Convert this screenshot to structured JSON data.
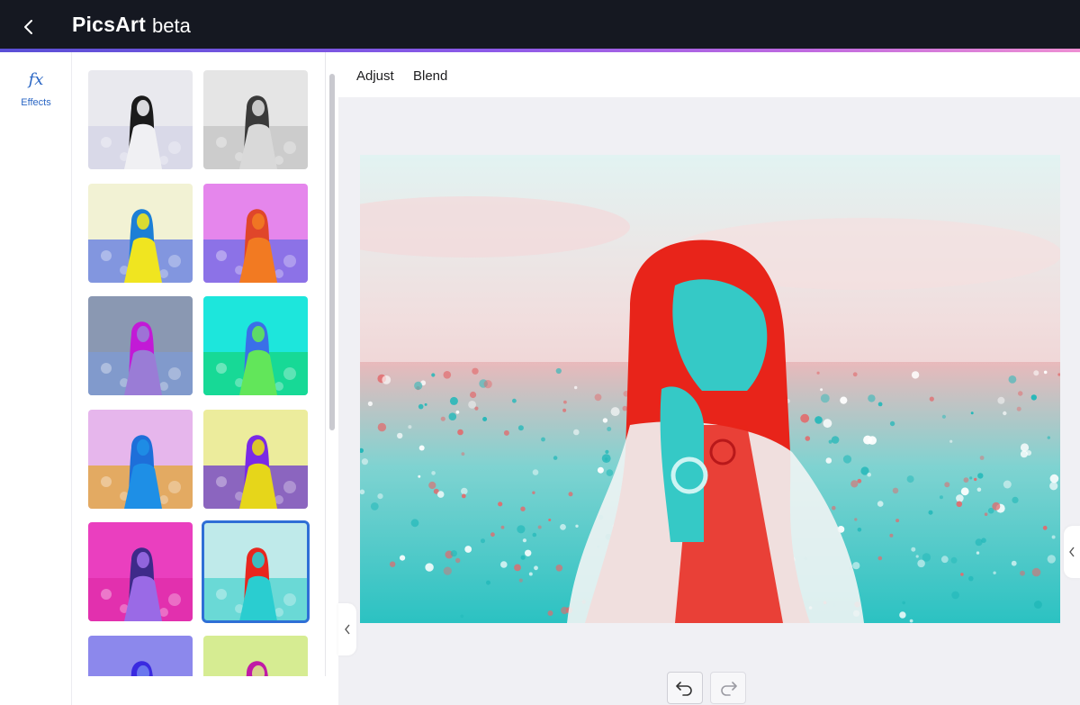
{
  "header": {
    "brand": "PicsArt",
    "badge": "beta",
    "back_icon": "chevron-left-icon"
  },
  "rail": {
    "items": [
      {
        "icon": "fx",
        "label": "Effects",
        "active": true
      }
    ],
    "accent_color": "#2a66c4"
  },
  "effects": {
    "thumbnails": [
      {
        "name": "original",
        "tint": "#e9e9ee",
        "hair": "#1b1b1b",
        "body": "#f0f0f3",
        "flowers": "#d6d6e6"
      },
      {
        "name": "black-white",
        "tint": "#e5e5e5",
        "hair": "#3a3a3a",
        "body": "#d9d9d9",
        "flowers": "#c8c8c8"
      },
      {
        "name": "yellow-blue",
        "tint": "#f2f2d4",
        "hair": "#1c7fd6",
        "body": "#f0e520",
        "flowers": "#6f86e0"
      },
      {
        "name": "magenta-orange",
        "tint": "#e586ec",
        "hair": "#e0462a",
        "body": "#f27a22",
        "flowers": "#7c6ee6"
      },
      {
        "name": "grey-purple",
        "tint": "#8a98b2",
        "hair": "#c21ad6",
        "body": "#9a7cd6",
        "flowers": "#7f9ad0"
      },
      {
        "name": "cyan-green",
        "tint": "#1de6dc",
        "hair": "#3a6fe8",
        "body": "#62e65a",
        "flowers": "#16d68a"
      },
      {
        "name": "pink-blue",
        "tint": "#e6b6ec",
        "hair": "#1e6fd9",
        "body": "#1e8fe6",
        "flowers": "#e2a84a"
      },
      {
        "name": "yellow-purple",
        "tint": "#ecec9c",
        "hair": "#7a2ae6",
        "body": "#e6d61a",
        "flowers": "#7a4ec6"
      },
      {
        "name": "magenta-violet",
        "tint": "#ea3fbf",
        "hair": "#3e2a8a",
        "body": "#9a6ae6",
        "flowers": "#e02eaa"
      },
      {
        "name": "red-cyan",
        "tint": "#bfeaea",
        "hair": "#e8261e",
        "body": "#2acdd0",
        "flowers": "#5ad6d2",
        "selected": true
      },
      {
        "name": "blue-indigo",
        "tint": "#8c88ec",
        "hair": "#3a2ae0",
        "body": "#7080f0",
        "flowers": "#9aa0f2"
      },
      {
        "name": "lime-magenta",
        "tint": "#d6ec92",
        "hair": "#c01aa6",
        "body": "#d8e88a",
        "flowers": "#c6e07a"
      }
    ]
  },
  "tabs": [
    {
      "label": "Adjust"
    },
    {
      "label": "Blend"
    }
  ],
  "canvas": {
    "photo_effect": "red-cyan",
    "colors": {
      "sky": "#dcefef",
      "flowers": "#3ecfcf",
      "hair": "#e8241a",
      "skin": "#35c9c6"
    }
  },
  "controls": {
    "undo_icon": "undo-icon",
    "redo_icon": "redo-icon",
    "collapse_left_icon": "chevron-left-icon",
    "collapse_right_icon": "chevron-left-icon"
  }
}
